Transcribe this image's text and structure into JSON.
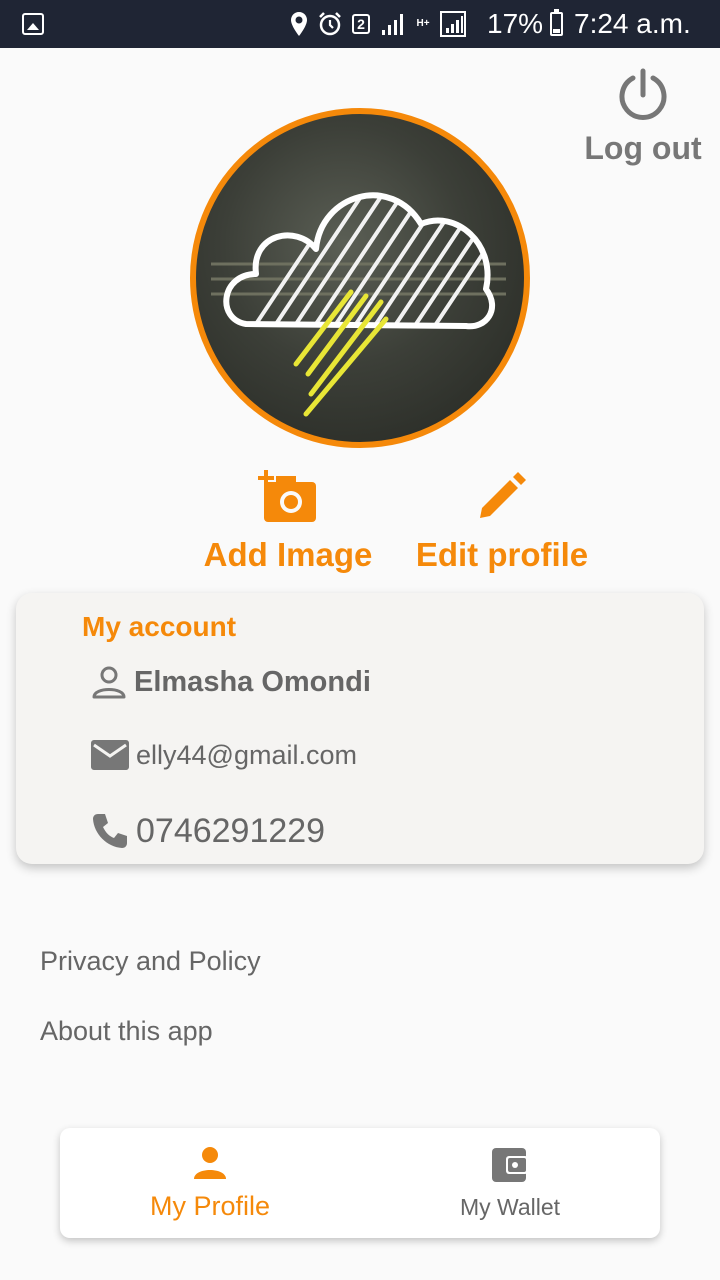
{
  "status_bar": {
    "battery_percent": "17%",
    "time": "7:24 a.m.",
    "sim_badge": "2",
    "network_type": "H+",
    "icons": [
      "image-notification-icon",
      "location-icon",
      "alarm-icon",
      "sim-2-icon",
      "signal-icon",
      "hplus-signal-icon",
      "battery-icon"
    ]
  },
  "header": {
    "logout_label": "Log out",
    "logout_icon": "power-icon"
  },
  "profile": {
    "avatar_description_icon": "neon-cloud-avatar"
  },
  "actions": {
    "add_image_label": "Add Image",
    "add_image_icon": "add-photo-icon",
    "edit_profile_label": "Edit profile",
    "edit_profile_icon": "pencil-icon"
  },
  "account": {
    "title": "My account",
    "name": "Elmasha Omondi",
    "email": "elly44@gmail.com",
    "phone": "0746291229"
  },
  "links": {
    "privacy": "Privacy and Policy",
    "about": "About this app"
  },
  "bottom_nav": {
    "items": [
      {
        "label": "My Profile",
        "icon": "person-icon",
        "active": true
      },
      {
        "label": "My Wallet",
        "icon": "wallet-icon",
        "active": false
      }
    ]
  },
  "colors": {
    "accent": "#f5890a",
    "status_bar": "#1f2534",
    "text_grey": "#666666",
    "background": "#fafafa"
  }
}
